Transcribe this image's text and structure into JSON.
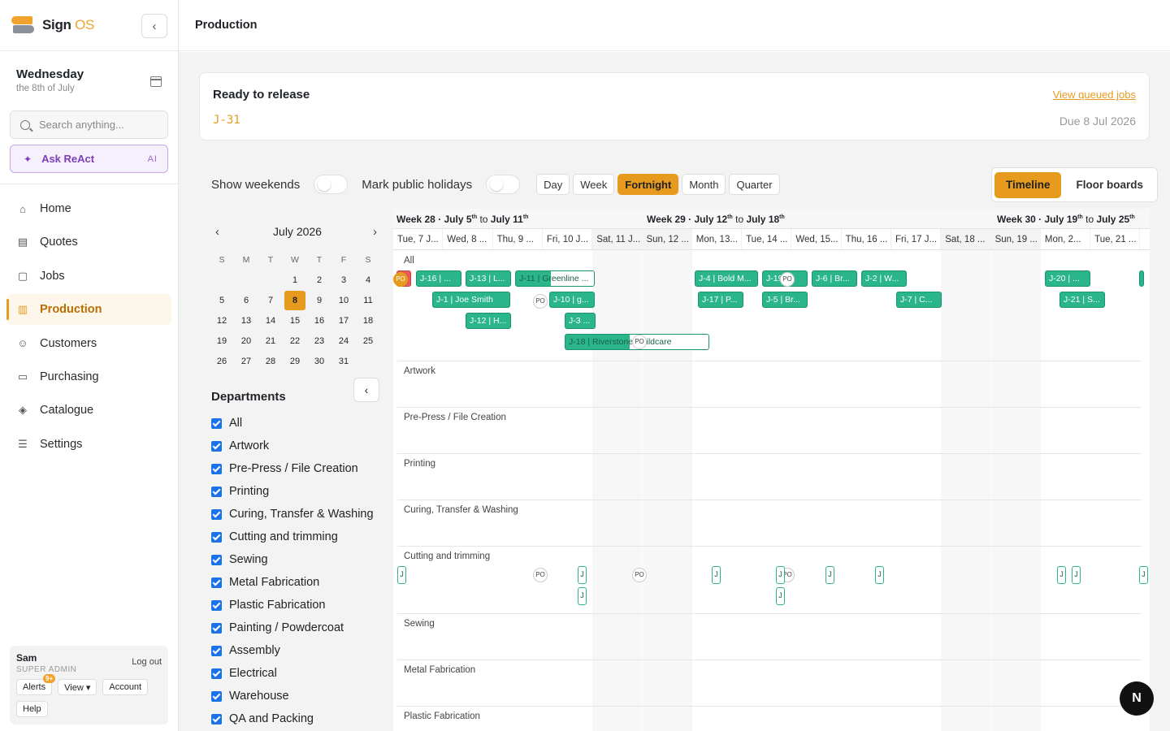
{
  "brand": {
    "name": "Sign ",
    "name_accent": "OS"
  },
  "date": {
    "day": "Wednesday",
    "sub": "the 8th of July"
  },
  "search": {
    "placeholder": "Search anything..."
  },
  "ask": {
    "label": "Ask ReAct",
    "ai": "AI"
  },
  "nav": [
    {
      "label": "Home",
      "icon": "home-icon"
    },
    {
      "label": "Quotes",
      "icon": "document-icon"
    },
    {
      "label": "Jobs",
      "icon": "clipboard-icon"
    },
    {
      "label": "Production",
      "icon": "bar-chart-icon"
    },
    {
      "label": "Customers",
      "icon": "users-icon"
    },
    {
      "label": "Purchasing",
      "icon": "monitor-icon"
    },
    {
      "label": "Catalogue",
      "icon": "box-icon"
    },
    {
      "label": "Settings",
      "icon": "sliders-icon"
    }
  ],
  "user": {
    "name": "Sam",
    "role": "SUPER ADMIN",
    "logout": "Log out",
    "alerts": "Alerts",
    "alerts_badge": "9+",
    "view": "View ▾",
    "account": "Account",
    "help": "Help"
  },
  "header": {
    "title": "Production"
  },
  "release": {
    "title": "Ready to release",
    "job": "J-31",
    "link": "View queued jobs",
    "due": "Due 8 Jul 2026"
  },
  "controls": {
    "weekends": "Show weekends",
    "holidays": "Mark public holidays",
    "ranges": [
      "Day",
      "Week",
      "Fortnight",
      "Month",
      "Quarter"
    ],
    "active_range": "Fortnight"
  },
  "views": {
    "timeline": "Timeline",
    "floor": "Floor boards"
  },
  "calendar": {
    "month": "July 2026",
    "dow": [
      "S",
      "M",
      "T",
      "W",
      "T",
      "F",
      "S"
    ],
    "days": [
      "",
      "",
      "",
      "1",
      "2",
      "3",
      "4",
      "5",
      "6",
      "7",
      "8",
      "9",
      "10",
      "11",
      "12",
      "13",
      "14",
      "15",
      "16",
      "17",
      "18",
      "19",
      "20",
      "21",
      "22",
      "23",
      "24",
      "25",
      "26",
      "27",
      "28",
      "29",
      "30",
      "31"
    ],
    "today": "8"
  },
  "departments": {
    "title": "Departments",
    "items": [
      "All",
      "Artwork",
      "Pre-Press / File Creation",
      "Printing",
      "Curing, Transfer & Washing",
      "Cutting and trimming",
      "Sewing",
      "Metal Fabrication",
      "Plastic Fabrication",
      "Painting / Powdercoat",
      "Assembly",
      "Electrical",
      "Warehouse",
      "QA and Packing"
    ]
  },
  "timeline": {
    "weeks": [
      {
        "label": "Week 28",
        "from": "July 5",
        "to": "July 11"
      },
      {
        "label": "Week 29",
        "from": "July 12",
        "to": "July 18"
      },
      {
        "label": "Week 30",
        "from": "July 19",
        "to": "July 25"
      }
    ],
    "sup": "th",
    "to_word": "to",
    "days": [
      {
        "label": "Tue, 7 J...",
        "weekend": false
      },
      {
        "label": "Wed, 8 ...",
        "weekend": false
      },
      {
        "label": "Thu, 9 ...",
        "weekend": false
      },
      {
        "label": "Fri, 10 J...",
        "weekend": false
      },
      {
        "label": "Sat, 11 J...",
        "weekend": true
      },
      {
        "label": "Sun, 12 ...",
        "weekend": true
      },
      {
        "label": "Mon, 13...",
        "weekend": false
      },
      {
        "label": "Tue, 14 ...",
        "weekend": false
      },
      {
        "label": "Wed, 15...",
        "weekend": false
      },
      {
        "label": "Thu, 16 ...",
        "weekend": false
      },
      {
        "label": "Fri, 17 J...",
        "weekend": false
      },
      {
        "label": "Sat, 18 ...",
        "weekend": true
      },
      {
        "label": "Sun, 19 ...",
        "weekend": true
      },
      {
        "label": "Mon, 2...",
        "weekend": false
      },
      {
        "label": "Tue, 21 ...",
        "weekend": false
      }
    ],
    "lanes": [
      "All",
      "Artwork",
      "Pre-Press / File Creation",
      "Printing",
      "Curing, Transfer & Washing",
      "Cutting and trimming",
      "Sewing",
      "Metal Fabrication",
      "Plastic Fabrication"
    ],
    "jobs": [
      "J-16 | ...",
      "J-13 | L...",
      "J-11 | Greenline ...",
      "J-1 | Joe Smith",
      "J-10 | g...",
      "J-12 | H...",
      "J-3 ...",
      "J-18 | Riverstone Childcare",
      "J-4 | Bold M...",
      "J-19 ...",
      "J-6 | Br...",
      "J-2 | W...",
      "J-17 | P...",
      "J-5 | Br...",
      "J-7 | C...",
      "J-20 | ...",
      "J-21 | S..."
    ],
    "po": "PO",
    "tick": "J"
  },
  "fab": "N"
}
